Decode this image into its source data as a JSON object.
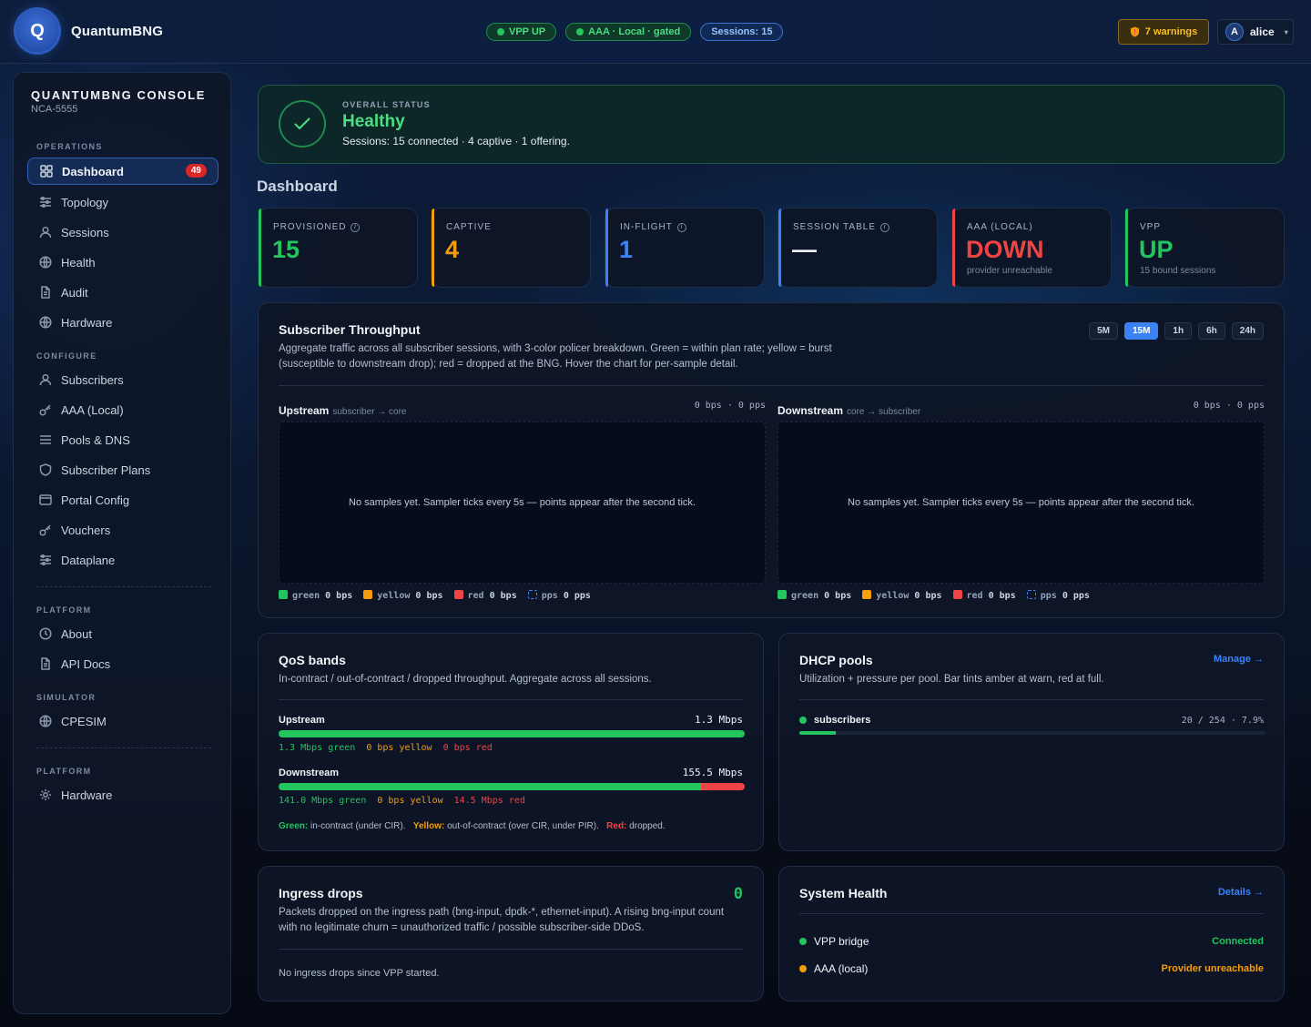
{
  "header": {
    "logo_letter": "Q",
    "brand": "QuantumBNG",
    "pills": [
      {
        "label": "VPP UP",
        "variant": "green",
        "dot": true
      },
      {
        "label": "AAA · Local · gated",
        "variant": "green",
        "dot": true
      },
      {
        "label": "Sessions: 15",
        "variant": "blue",
        "dot": false
      }
    ],
    "warnings_label": "7 warnings",
    "user_initial": "A",
    "user_name": "alice"
  },
  "sidebar": {
    "title": "QUANTUMBNG CONSOLE",
    "subtitle": "NCA-5555",
    "sections": {
      "operations": "OPERATIONS",
      "configure": "CONFIGURE",
      "platform": "PLATFORM",
      "simulator": "SIMULATOR",
      "platform2": "PLATFORM"
    },
    "items": [
      {
        "label": "Dashboard",
        "icon": "grid-icon",
        "badge": "49",
        "active": true
      },
      {
        "label": "Topology",
        "icon": "sliders-icon"
      },
      {
        "label": "Sessions",
        "icon": "user-icon"
      },
      {
        "label": "Health",
        "icon": "globe-icon"
      },
      {
        "label": "Audit",
        "icon": "document-icon"
      },
      {
        "label": "Hardware",
        "icon": "globe-icon"
      },
      {
        "label": "Subscribers",
        "icon": "user-icon"
      },
      {
        "label": "AAA (Local)",
        "icon": "key-icon"
      },
      {
        "label": "Pools & DNS",
        "icon": "list-icon"
      },
      {
        "label": "Subscriber Plans",
        "icon": "shield-icon"
      },
      {
        "label": "Portal Config",
        "icon": "window-icon"
      },
      {
        "label": "Vouchers",
        "icon": "key-icon"
      },
      {
        "label": "Dataplane",
        "icon": "sliders-icon"
      },
      {
        "label": "About",
        "icon": "clock-icon"
      },
      {
        "label": "API Docs",
        "icon": "document-icon"
      },
      {
        "label": "CPESIM",
        "icon": "globe-icon"
      },
      {
        "label": "Hardware",
        "icon": "gear-icon"
      }
    ]
  },
  "status": {
    "label": "OVERALL STATUS",
    "value": "Healthy",
    "summary": "Sessions: 15 connected · 4 captive · 1 offering."
  },
  "page_title": "Dashboard",
  "kpis": [
    {
      "label": "PROVISIONED",
      "value": "15",
      "sub": "",
      "color": "#22c55e",
      "info": true
    },
    {
      "label": "CAPTIVE",
      "value": "4",
      "sub": "",
      "color": "#f59e0b",
      "info": false
    },
    {
      "label": "IN-FLIGHT",
      "value": "1",
      "sub": "",
      "color": "#3b82f6",
      "info": true
    },
    {
      "label": "SESSION TABLE",
      "value": "—",
      "sub": "",
      "color": "#3b82f6",
      "info": true
    },
    {
      "label": "AAA (LOCAL)",
      "value": "DOWN",
      "sub": "provider unreachable",
      "color": "#ef4444",
      "info": false
    },
    {
      "label": "VPP",
      "value": "UP",
      "sub": "15 bound sessions",
      "color": "#22c55e",
      "info": false
    }
  ],
  "throughput": {
    "title": "Subscriber Throughput",
    "description": "Aggregate traffic across all subscriber sessions, with 3-color policer breakdown. Green = within plan rate; yellow = burst (susceptible to downstream drop); red = dropped at the BNG. Hover the chart for per-sample detail.",
    "ranges": [
      "5M",
      "15M",
      "1h",
      "6h",
      "24h"
    ],
    "active_range": "15M",
    "panels": [
      {
        "title": "Upstream",
        "direction": "subscriber → core",
        "rate": "0 bps · 0 pps",
        "empty": "No samples yet. Sampler ticks every 5s — points appear after the second tick.",
        "legend": [
          {
            "name": "green",
            "value": "0 bps",
            "color": "#22c55e"
          },
          {
            "name": "yellow",
            "value": "0 bps",
            "color": "#f59e0b"
          },
          {
            "name": "red",
            "value": "0 bps",
            "color": "#ef4444"
          },
          {
            "name": "pps",
            "value": "0 pps",
            "color": "#3b82f6"
          }
        ]
      },
      {
        "title": "Downstream",
        "direction": "core → subscriber",
        "rate": "0 bps · 0 pps",
        "empty": "No samples yet. Sampler ticks every 5s — points appear after the second tick.",
        "legend": [
          {
            "name": "green",
            "value": "0 bps",
            "color": "#22c55e"
          },
          {
            "name": "yellow",
            "value": "0 bps",
            "color": "#f59e0b"
          },
          {
            "name": "red",
            "value": "0 bps",
            "color": "#ef4444"
          },
          {
            "name": "pps",
            "value": "0 pps",
            "color": "#3b82f6"
          }
        ]
      }
    ]
  },
  "qos": {
    "title": "QoS bands",
    "description": "In-contract / out-of-contract / dropped throughput. Aggregate across all sessions.",
    "bands": [
      {
        "name": "Upstream",
        "total": "1.3 Mbps",
        "green": "1.3 Mbps",
        "yellow": "0 bps",
        "red": "0 bps",
        "green_frac": 1.0,
        "yellow_frac": 0.0,
        "red_frac": 0.0
      },
      {
        "name": "Downstream",
        "total": "155.5 Mbps",
        "green": "141.0 Mbps",
        "yellow": "0 bps",
        "red": "14.5 Mbps",
        "green_frac": 0.907,
        "yellow_frac": 0.0,
        "red_frac": 0.093
      }
    ],
    "suffix_green": "green",
    "suffix_yellow": "yellow",
    "suffix_red": "red",
    "footer": {
      "green_key": "Green:",
      "green_text": "in-contract (under CIR).",
      "yellow_key": "Yellow:",
      "yellow_text": "out-of-contract (over CIR, under PIR).",
      "red_key": "Red:",
      "red_text": "dropped."
    }
  },
  "dhcp": {
    "title": "DHCP pools",
    "link": "Manage →",
    "description": "Utilization + pressure per pool. Bar tints amber at warn, red at full.",
    "pools": [
      {
        "name": "subscribers",
        "usage": "20 / 254 · 7.9%",
        "fraction": 0.079
      }
    ]
  },
  "ingress": {
    "title": "Ingress drops",
    "count": "0",
    "description": "Packets dropped on the ingress path (bng-input, dpdk-*, ethernet-input). A rising bng-input count with no legitimate churn = unauthorized traffic / possible subscriber-side DDoS.",
    "empty": "No ingress drops since VPP started."
  },
  "health": {
    "title": "System Health",
    "link": "Details →",
    "rows": [
      {
        "name": "VPP bridge",
        "status": "Connected",
        "color": "#22c55e"
      },
      {
        "name": "AAA (local)",
        "status": "Provider unreachable",
        "color": "#f59e0b"
      }
    ]
  }
}
